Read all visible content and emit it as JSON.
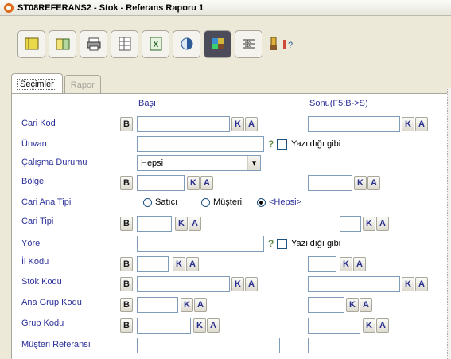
{
  "window": {
    "title": "ST08REFERANS2 - Stok - Referans Raporu 1"
  },
  "toolbar": {
    "buttons": [
      "book-icon",
      "open-book-icon",
      "printer-icon",
      "grid-icon",
      "excel-icon",
      "globe-icon",
      "color-palette-icon",
      "calculator-icon",
      "paint-bucket-icon",
      "help-icon"
    ]
  },
  "tabs": [
    {
      "label": "Seçimler",
      "active": true
    },
    {
      "label": "Rapor",
      "active": false
    }
  ],
  "headers": {
    "start": "Başı",
    "end": "Sonu(F5:B->S)"
  },
  "buttons": {
    "b": "B",
    "k": "K",
    "a": "A"
  },
  "fields": {
    "cari_kod": "Cari Kod",
    "unvan": "Ünvan",
    "calisma": "Çalışma Durumu",
    "bolge": "Bölge",
    "cari_ana_tipi": "Cari Ana Tipi",
    "cari_tipi": "Cari Tipi",
    "yore": "Yöre",
    "il_kodu": "İl Kodu",
    "stok_kodu": "Stok Kodu",
    "ana_grup": "Ana Grup Kodu",
    "grup_kodu": "Grup Kodu",
    "musteri_ref": "Müşteri Referansı"
  },
  "calisma_value": "Hepsi",
  "yazildigi_gibi": "Yazıldığı gibi",
  "question": "?",
  "radios": [
    "Satıcı",
    "Müşteri",
    "<Hepsi>"
  ],
  "radio_selected": "<Hepsi>"
}
